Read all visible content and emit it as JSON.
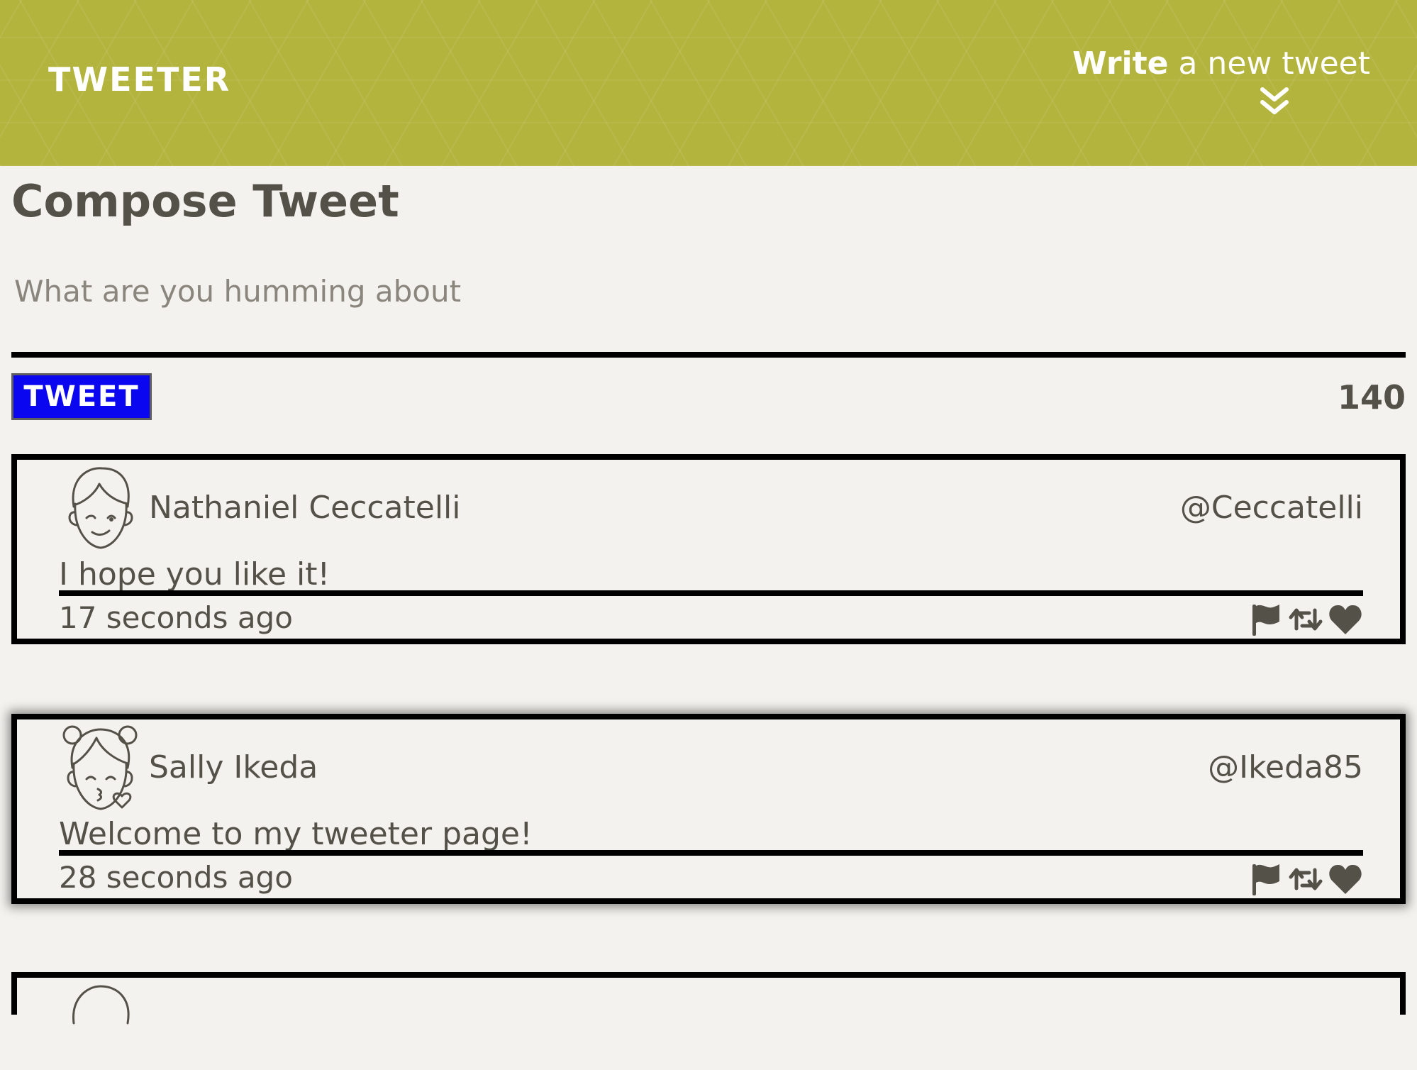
{
  "nav": {
    "brand": "TWEETER",
    "write_strong": "Write",
    "write_rest": " a new tweet",
    "toggle_icon": "double-chevron-down-icon"
  },
  "compose": {
    "title": "Compose Tweet",
    "placeholder": "What are you humming about",
    "button_label": "TWEET",
    "counter": "140"
  },
  "colors": {
    "nav_bg": "#b3b43d",
    "page_bg": "#f4f2ee",
    "text": "#545149",
    "button_bg": "#0a07f0"
  },
  "tweets": [
    {
      "name": "Nathaniel Ceccatelli",
      "handle": "@Ceccatelli",
      "content": "I hope you like it!",
      "time": "17 seconds ago",
      "avatar": "boy-winking-avatar"
    },
    {
      "name": "Sally Ikeda",
      "handle": "@Ikeda85",
      "content": "Welcome to my tweeter page!",
      "time": "28 seconds ago",
      "avatar": "girl-kissing-avatar"
    }
  ],
  "action_icons": [
    "flag-icon",
    "retweet-icon",
    "heart-icon"
  ]
}
